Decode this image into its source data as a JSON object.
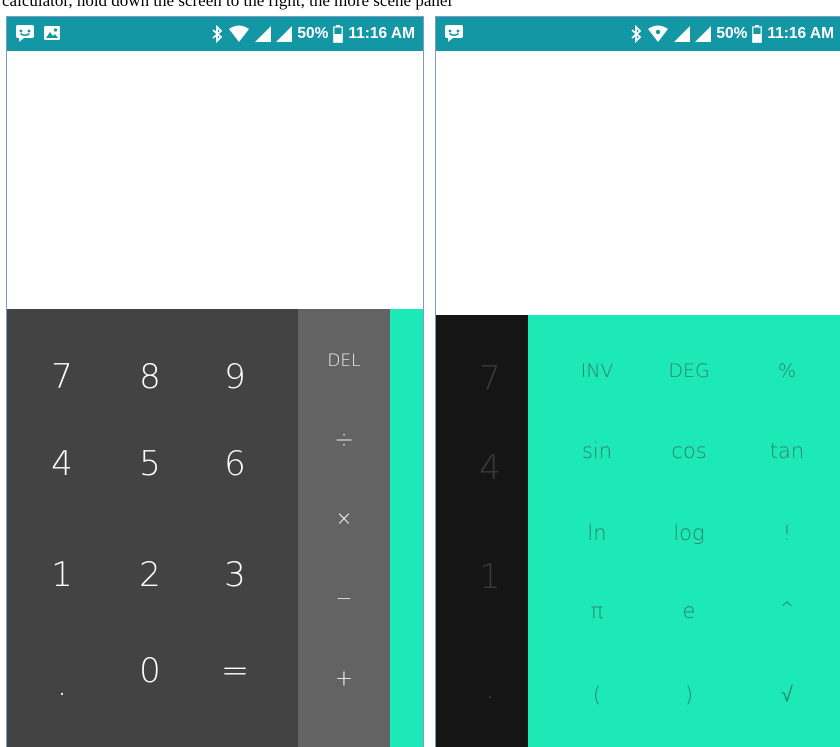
{
  "caption": "calculator, hold down the screen to the right, the more scene panel",
  "status_bar": {
    "battery": "50%",
    "time": "11:16 AM"
  },
  "colors": {
    "status_bar": "#1497a5",
    "number_pad": "#434343",
    "operator_pad": "#636363",
    "advanced_pad": "#1de9b6",
    "dim_pad": "#151515"
  },
  "left_screen": {
    "number_keys": [
      "7",
      "8",
      "9",
      "4",
      "5",
      "6",
      "1",
      "2",
      "3",
      ".",
      "0",
      "="
    ],
    "operator_keys": [
      "DEL",
      "÷",
      "×",
      "−",
      "+"
    ]
  },
  "right_screen": {
    "dim_keys": [
      "7",
      "4",
      "1",
      "."
    ],
    "advanced_keys": [
      "INV",
      "DEG",
      "%",
      "sin",
      "cos",
      "tan",
      "ln",
      "log",
      "!",
      "π",
      "e",
      "^",
      "(",
      ")",
      "√"
    ]
  }
}
